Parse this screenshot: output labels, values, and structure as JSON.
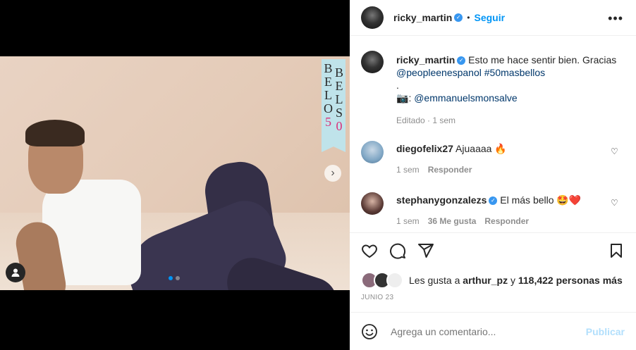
{
  "post": {
    "banner_left_letters": [
      "B",
      "E",
      "L",
      "O"
    ],
    "banner_left_number": "5",
    "banner_right_letters": [
      "B",
      "E",
      "L",
      "O",
      "S"
    ],
    "banner_right_number": "0",
    "next_icon": "chevron-right-icon",
    "tag_icon": "user-tag-icon"
  },
  "header": {
    "username": "ricky_martin",
    "separator": "•",
    "follow_label": "Seguir",
    "more_icon": "•••"
  },
  "caption": {
    "username": "ricky_martin",
    "text": "Esto me hace sentir bien. Gracias",
    "mention": "@peopleenespanol",
    "hashtag": "#50masbellos",
    "dot": ".",
    "camera_icon": "📷",
    "credit_prefix": ":",
    "credit_mention": "@emmanuelsmonsalve",
    "meta": "Editado · 1 sem"
  },
  "comments": [
    {
      "username": "diegofelix27",
      "text": "Ajuaaaa 🔥",
      "time": "1 sem",
      "likes": "",
      "reply": "Responder",
      "avatar_color": "#7fa6c4"
    },
    {
      "username": "stephanygonzalezs",
      "text": "El más bello 🤩❤️",
      "time": "1 sem",
      "likes": "36 Me gusta",
      "reply": "Responder",
      "avatar_color": "#5a3a35"
    }
  ],
  "likes": {
    "prefix": "Les gusta a",
    "user": "arthur_pz",
    "conj": "y",
    "count": "118,422 personas más"
  },
  "date": "JUNIO 23",
  "comment_input": {
    "placeholder": "Agrega un comentario...",
    "publish": "Publicar",
    "emoji_icon": "emoji-icon"
  },
  "colors": {
    "accent": "#0095f6",
    "verified": "#3897f0",
    "link": "#00376b"
  }
}
